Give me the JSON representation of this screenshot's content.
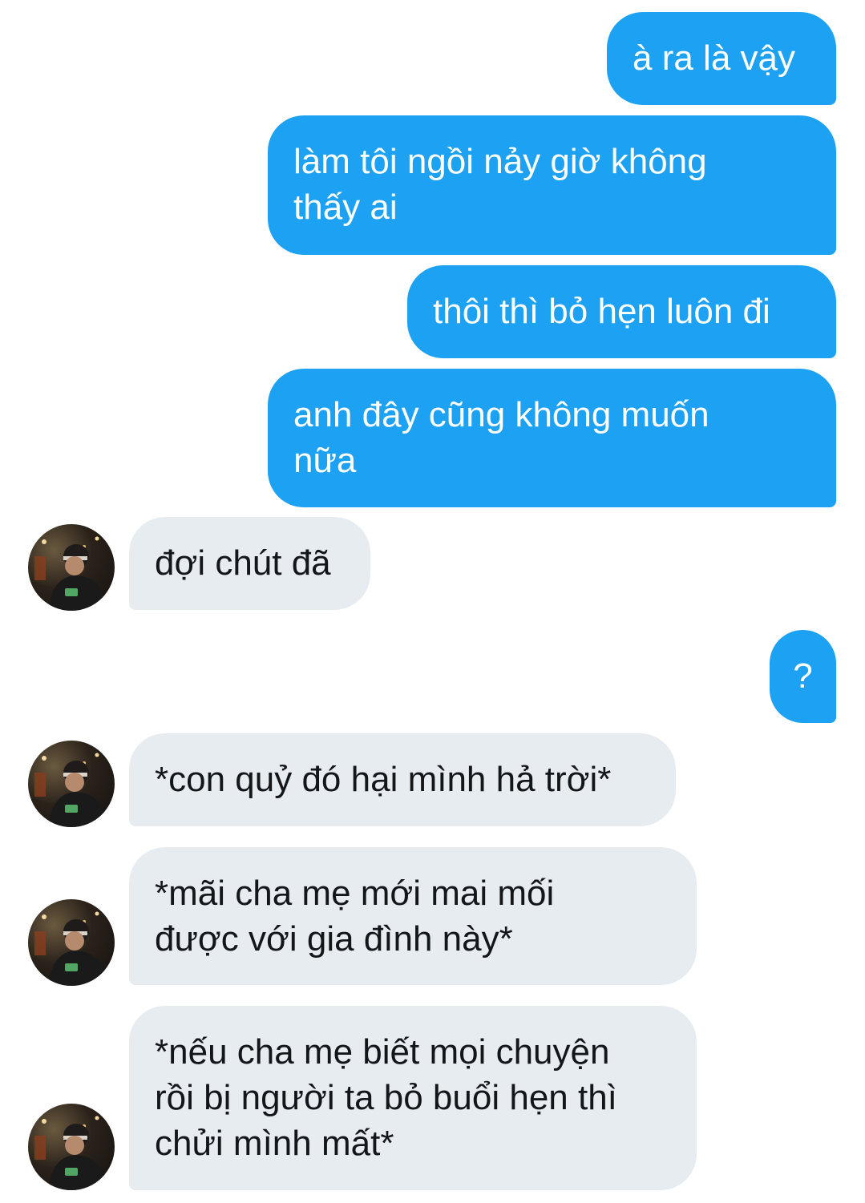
{
  "messages": [
    {
      "from": "me",
      "text": "à ra là vậy"
    },
    {
      "from": "me",
      "text": "làm tôi ngồi nảy giờ không\nthấy ai"
    },
    {
      "from": "me",
      "text": "thôi thì bỏ hẹn luôn đi"
    },
    {
      "from": "me",
      "text": "anh đây cũng không muốn\nnữa"
    },
    {
      "from": "them",
      "text": "đợi chút đã"
    },
    {
      "from": "me",
      "text": "?"
    },
    {
      "from": "them",
      "text": "*con quỷ đó hại mình hả trời*"
    },
    {
      "from": "them",
      "text": "*mãi cha mẹ mới mai mối\nđược với gia đình này*"
    },
    {
      "from": "them",
      "text": "*nếu cha mẹ biết mọi chuyện\nrồi bị người ta bỏ buổi hẹn thì\nchửi mình mất*"
    }
  ],
  "colors": {
    "sent_bubble": "#1da1f2",
    "received_bubble": "#e6ecf0",
    "sent_text": "#ffffff",
    "received_text": "#14171a"
  },
  "icons": {
    "avatar": "user-avatar-photo"
  }
}
